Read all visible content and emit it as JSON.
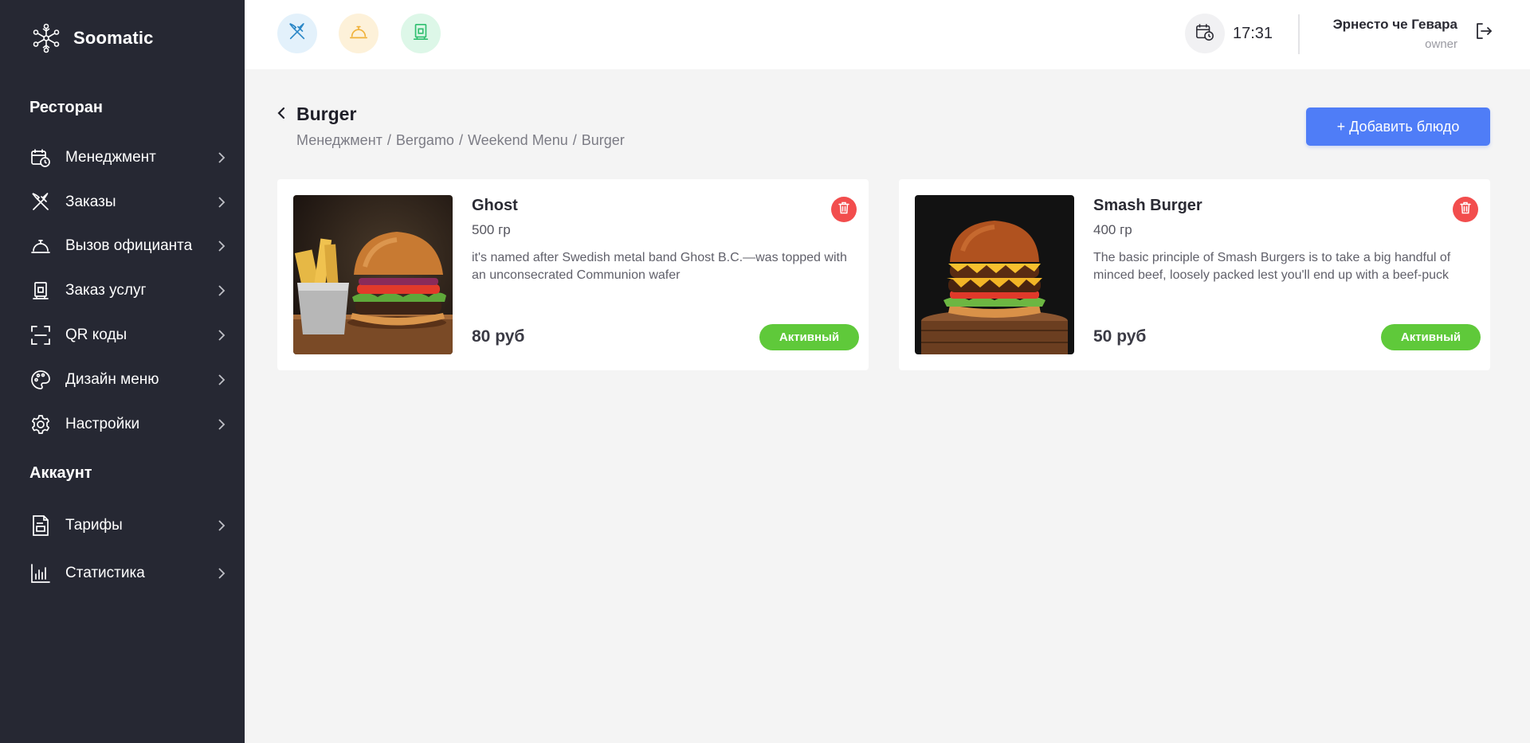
{
  "brand": {
    "name": "Soomatic",
    "icon": "snowflake-network-icon"
  },
  "sidebar": {
    "section_restaurant": "Ресторан",
    "restaurant_items": [
      {
        "label": "Менеджмент",
        "icon": "calendar-clock-icon"
      },
      {
        "label": "Заказы",
        "icon": "cutlery-icon"
      },
      {
        "label": "Вызов официанта",
        "icon": "service-bell-icon"
      },
      {
        "label": "Заказ услуг",
        "icon": "hotel-service-icon"
      },
      {
        "label": "QR коды",
        "icon": "qr-scan-icon"
      },
      {
        "label": "Дизайн меню",
        "icon": "palette-icon"
      },
      {
        "label": "Настройки",
        "icon": "gear-icon"
      }
    ],
    "section_account": "Аккаунт",
    "account_items": [
      {
        "label": "Тарифы",
        "icon": "document-icon"
      },
      {
        "label": "Статистика",
        "icon": "bar-chart-icon"
      }
    ]
  },
  "header": {
    "quick_buttons": [
      {
        "icon": "cutlery-icon",
        "color": "#2b87c7",
        "bg": "#e3f1fb"
      },
      {
        "icon": "service-bell-icon",
        "color": "#f0b13a",
        "bg": "#fdf1d9"
      },
      {
        "icon": "hotel-service-icon",
        "color": "#2fbf6f",
        "bg": "#ddf7e8"
      }
    ],
    "time": "17:31",
    "user_name": "Эрнесто че Гевара",
    "user_role": "owner"
  },
  "page": {
    "title": "Burger",
    "breadcrumb": [
      "Менеджмент",
      "Bergamo",
      "Weekend Menu",
      "Burger"
    ],
    "add_button": "+ Добавить блюдо"
  },
  "dishes": [
    {
      "name": "Ghost",
      "weight": "500 гр",
      "description": "it's named after Swedish metal band Ghost B.C.—was topped with an unconsecrated Communion wafer",
      "price": "80 руб",
      "status": "Активный"
    },
    {
      "name": "Smash Burger",
      "weight": "400 гр",
      "description": "The basic principle of Smash Burgers is to take a big handful of minced beef, loosely packed lest you'll end up with a beef-puck",
      "price": "50 руб",
      "status": "Активный"
    }
  ],
  "colors": {
    "sidebar_bg": "#262833",
    "accent": "#4f7df7",
    "active_badge": "#5fc93a",
    "delete": "#f24d4d"
  }
}
